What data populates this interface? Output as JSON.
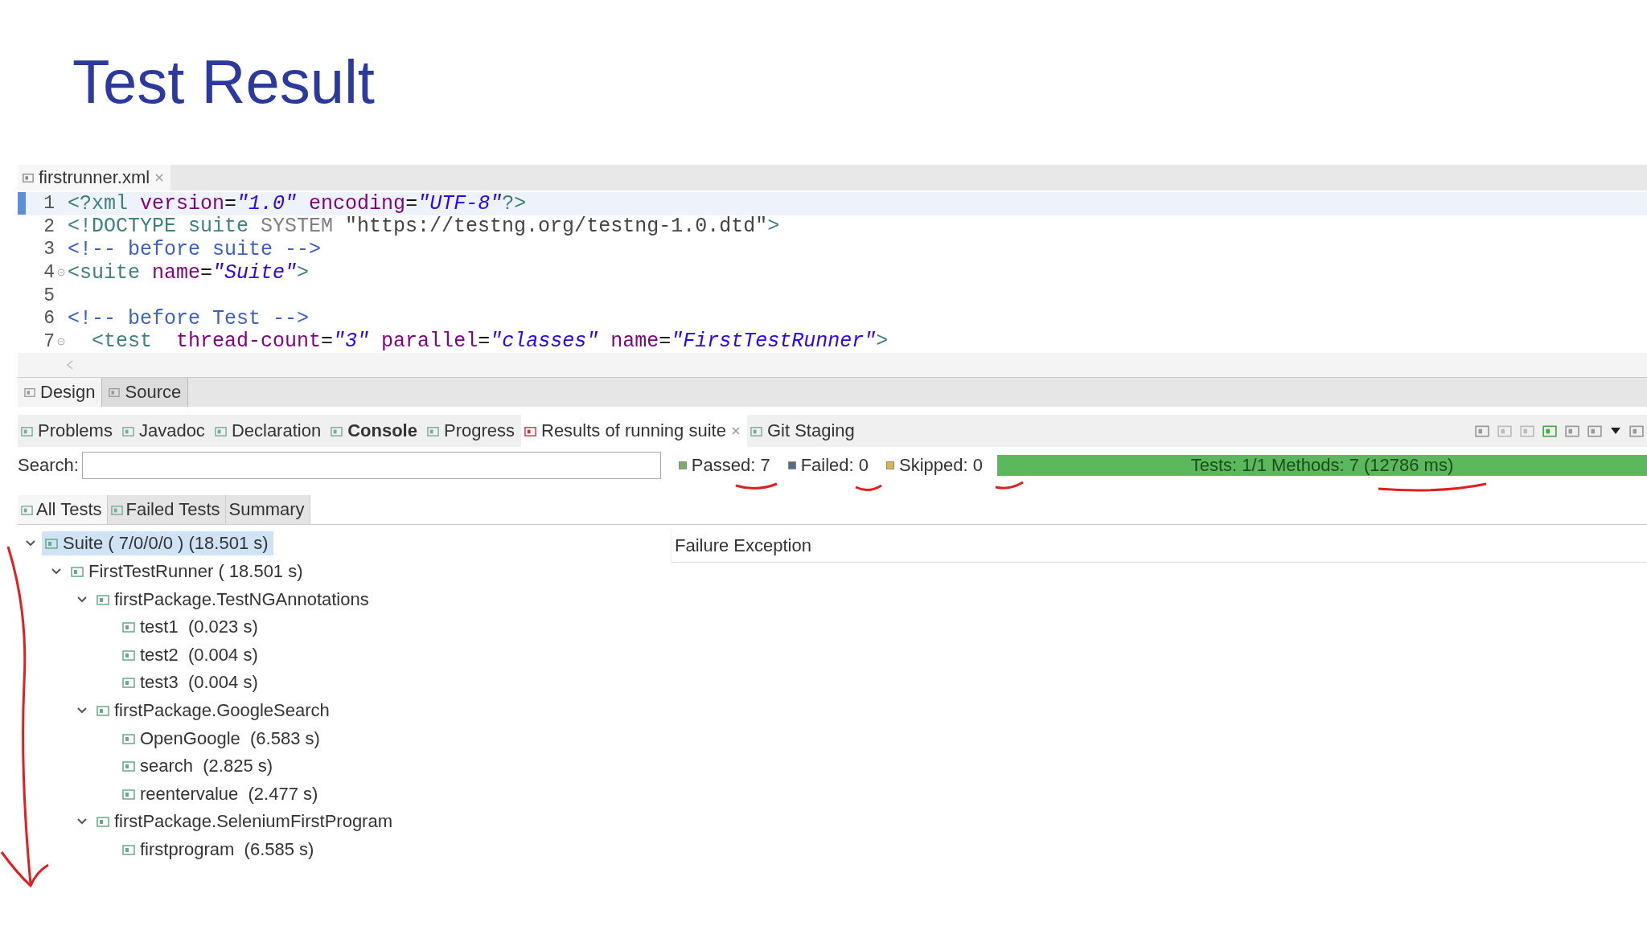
{
  "slide_title": "Test Result",
  "editor": {
    "tab": {
      "label": "firstrunner.xml",
      "selected": true
    },
    "lines": [
      {
        "number": "1",
        "fold": false,
        "current": true,
        "tokens": [
          {
            "kind": "punct",
            "text": "<?"
          },
          {
            "kind": "tag",
            "text": "xml"
          },
          {
            "kind": "attr",
            "text": " version"
          },
          {
            "kind": "plain",
            "text": "="
          },
          {
            "kind": "value",
            "text": "\"1.0\""
          },
          {
            "kind": "attr",
            "text": " encoding"
          },
          {
            "kind": "plain",
            "text": "="
          },
          {
            "kind": "value",
            "text": "\"UTF-8\""
          },
          {
            "kind": "punct",
            "text": "?>"
          }
        ]
      },
      {
        "number": "2",
        "fold": false,
        "current": false,
        "tokens": [
          {
            "kind": "punct",
            "text": "<!DOCTYPE "
          },
          {
            "kind": "tag",
            "text": "suite "
          },
          {
            "kind": "keyword",
            "text": "SYSTEM "
          },
          {
            "kind": "string",
            "text": "\"https://testng.org/testng-1.0.dtd\""
          },
          {
            "kind": "punct",
            "text": ">"
          }
        ]
      },
      {
        "number": "3",
        "fold": false,
        "current": false,
        "tokens": [
          {
            "kind": "comment",
            "text": "<!-- before suite -->"
          }
        ]
      },
      {
        "number": "4",
        "fold": true,
        "current": false,
        "tokens": [
          {
            "kind": "tag",
            "text": "<suite"
          },
          {
            "kind": "attr",
            "text": " name"
          },
          {
            "kind": "plain",
            "text": "="
          },
          {
            "kind": "value",
            "text": "\"Suite\""
          },
          {
            "kind": "tag",
            "text": ">"
          }
        ]
      },
      {
        "number": "5",
        "fold": false,
        "current": false
      },
      {
        "number": "6",
        "fold": false,
        "current": false,
        "tokens": [
          {
            "kind": "comment",
            "text": "<!-- before Test -->"
          }
        ]
      },
      {
        "number": "7",
        "fold": true,
        "current": false,
        "tokens": [
          {
            "kind": "tag",
            "text": "  <test"
          },
          {
            "kind": "attr",
            "text": "  thread-count"
          },
          {
            "kind": "plain",
            "text": "="
          },
          {
            "kind": "value",
            "text": "\"3\""
          },
          {
            "kind": "attr",
            "text": " parallel"
          },
          {
            "kind": "plain",
            "text": "="
          },
          {
            "kind": "value",
            "text": "\"classes\""
          },
          {
            "kind": "attr",
            "text": " name"
          },
          {
            "kind": "plain",
            "text": "="
          },
          {
            "kind": "value",
            "text": "\"FirstTestRunner\""
          },
          {
            "kind": "tag",
            "text": ">"
          }
        ]
      }
    ],
    "bottom_tabs": [
      {
        "label": "Design",
        "selected": true
      },
      {
        "label": "Source",
        "selected": false
      }
    ]
  },
  "views": {
    "tabs": [
      {
        "label": "Problems",
        "selected": false,
        "bold": false,
        "closable": false
      },
      {
        "label": "Javadoc",
        "selected": false,
        "bold": false,
        "closable": false
      },
      {
        "label": "Declaration",
        "selected": false,
        "bold": false,
        "closable": false
      },
      {
        "label": "Console",
        "selected": false,
        "bold": true,
        "closable": false
      },
      {
        "label": "Progress",
        "selected": false,
        "bold": false,
        "closable": false
      },
      {
        "label": "Results of running suite",
        "selected": true,
        "bold": false,
        "closable": true
      },
      {
        "label": "Git Staging",
        "selected": false,
        "bold": false,
        "closable": false
      }
    ]
  },
  "results": {
    "search_label": "Search:",
    "counters": [
      {
        "text": "Passed: 7",
        "color": "#7fae6a"
      },
      {
        "text": "Failed: 0",
        "color": "#5a6a8a"
      },
      {
        "text": "Skipped: 0",
        "color": "#d8b84a"
      }
    ],
    "progress": {
      "level": 1,
      "text": "Tests: 1/1  Methods: 7 (12786 ms)"
    },
    "tabs": [
      {
        "label": "All Tests",
        "selected": true
      },
      {
        "label": "Failed Tests",
        "selected": false
      },
      {
        "label": "Summary",
        "selected": false
      }
    ],
    "tree": [
      {
        "label": "Suite ( 7/0/0/0 ) (18.501 s)",
        "selected": true,
        "expanded": true,
        "children": [
          {
            "label": "FirstTestRunner ( 18.501 s)",
            "selected": false,
            "expanded": true,
            "children": [
              {
                "label": "firstPackage.TestNGAnnotations",
                "selected": false,
                "expanded": true,
                "children": [
                  {
                    "label": "test1  (0.023 s)",
                    "selected": false
                  },
                  {
                    "label": "test2  (0.004 s)",
                    "selected": false
                  },
                  {
                    "label": "test3  (0.004 s)",
                    "selected": false
                  }
                ]
              },
              {
                "label": "firstPackage.GoogleSearch",
                "selected": false,
                "expanded": true,
                "children": [
                  {
                    "label": "OpenGoogle  (6.583 s)",
                    "selected": false
                  },
                  {
                    "label": "search  (2.825 s)",
                    "selected": false
                  },
                  {
                    "label": "reentervalue  (2.477 s)",
                    "selected": false
                  }
                ]
              },
              {
                "label": "firstPackage.SeleniumFirstProgram",
                "selected": false,
                "expanded": true,
                "children": [
                  {
                    "label": "firstprogram  (6.585 s)",
                    "selected": false
                  }
                ]
              }
            ]
          }
        ]
      }
    ],
    "detail_header": "Failure Exception"
  }
}
